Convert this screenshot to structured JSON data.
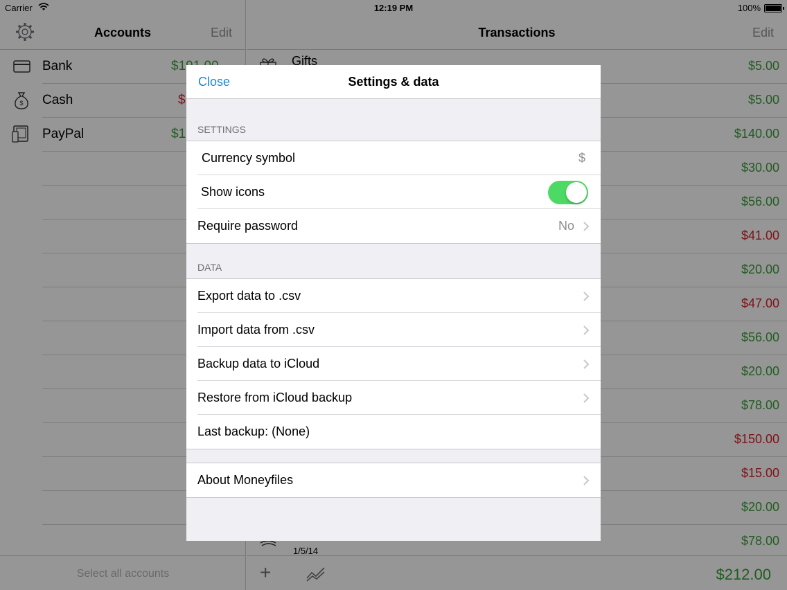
{
  "status_bar": {
    "carrier": "Carrier",
    "time": "12:19 PM",
    "battery": "100%"
  },
  "accounts_pane": {
    "title": "Accounts",
    "edit_label": "Edit",
    "accounts": [
      {
        "name": "Bank",
        "amount": "$191.00",
        "icon": "credit-card-icon",
        "color": "#3a9a3a"
      },
      {
        "name": "Cash",
        "amount": "$",
        "icon": "money-bag-icon",
        "color": "#d0202a"
      },
      {
        "name": "PayPal",
        "amount": "$1",
        "icon": "device-icon",
        "color": "#3a9a3a"
      }
    ],
    "footer_label": "Select all accounts"
  },
  "transactions_pane": {
    "title": "Transactions",
    "edit_label": "Edit",
    "first_item_label": "Gifts",
    "last_item_date": "1/5/14",
    "amounts": [
      {
        "value": "$5.00",
        "color": "green"
      },
      {
        "value": "$5.00",
        "color": "green"
      },
      {
        "value": "$140.00",
        "color": "green"
      },
      {
        "value": "$30.00",
        "color": "green"
      },
      {
        "value": "$56.00",
        "color": "green"
      },
      {
        "value": "$41.00",
        "color": "red"
      },
      {
        "value": "$20.00",
        "color": "green"
      },
      {
        "value": "$47.00",
        "color": "red"
      },
      {
        "value": "$56.00",
        "color": "green"
      },
      {
        "value": "$20.00",
        "color": "green"
      },
      {
        "value": "$78.00",
        "color": "green"
      },
      {
        "value": "$150.00",
        "color": "red"
      },
      {
        "value": "$15.00",
        "color": "red"
      },
      {
        "value": "$20.00",
        "color": "green"
      },
      {
        "value": "$78.00",
        "color": "green"
      }
    ],
    "total": "$212.00",
    "add_icon": "plus-icon",
    "chart_icon": "trend-chart-icon"
  },
  "modal": {
    "close_label": "Close",
    "title": "Settings & data",
    "settings_header": "SETTINGS",
    "currency_label": "Currency symbol",
    "currency_value": "$",
    "show_icons_label": "Show icons",
    "show_icons_on": true,
    "require_password_label": "Require password",
    "require_password_value": "No",
    "data_header": "DATA",
    "export_label": "Export data to .csv",
    "import_label": "Import data from .csv",
    "backup_label": "Backup data to iCloud",
    "restore_label": "Restore from iCloud backup",
    "last_backup_label": "Last backup: (None)",
    "about_label": "About Moneyfiles"
  },
  "colors": {
    "accent": "#1a8ad0",
    "toggle_on": "#4cd964",
    "positive": "#3a9a3a",
    "negative": "#d0202a"
  }
}
